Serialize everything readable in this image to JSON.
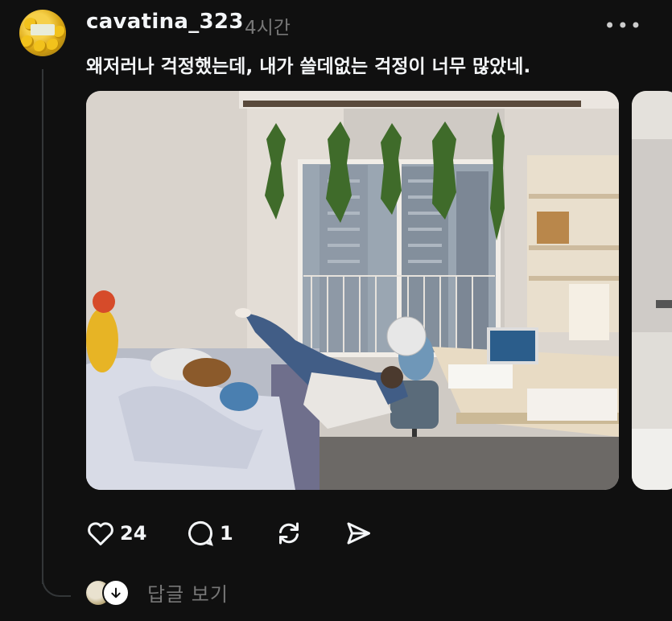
{
  "post": {
    "username": "cavatina_323",
    "time": "4시간",
    "more_label": "•••",
    "text": "왜저러나 걱정했는데, 내가 쓸데없는 걱정이 너무 많았네."
  },
  "actions": {
    "like_count": "24",
    "reply_count": "1"
  },
  "replies": {
    "label": "답글 보기"
  }
}
